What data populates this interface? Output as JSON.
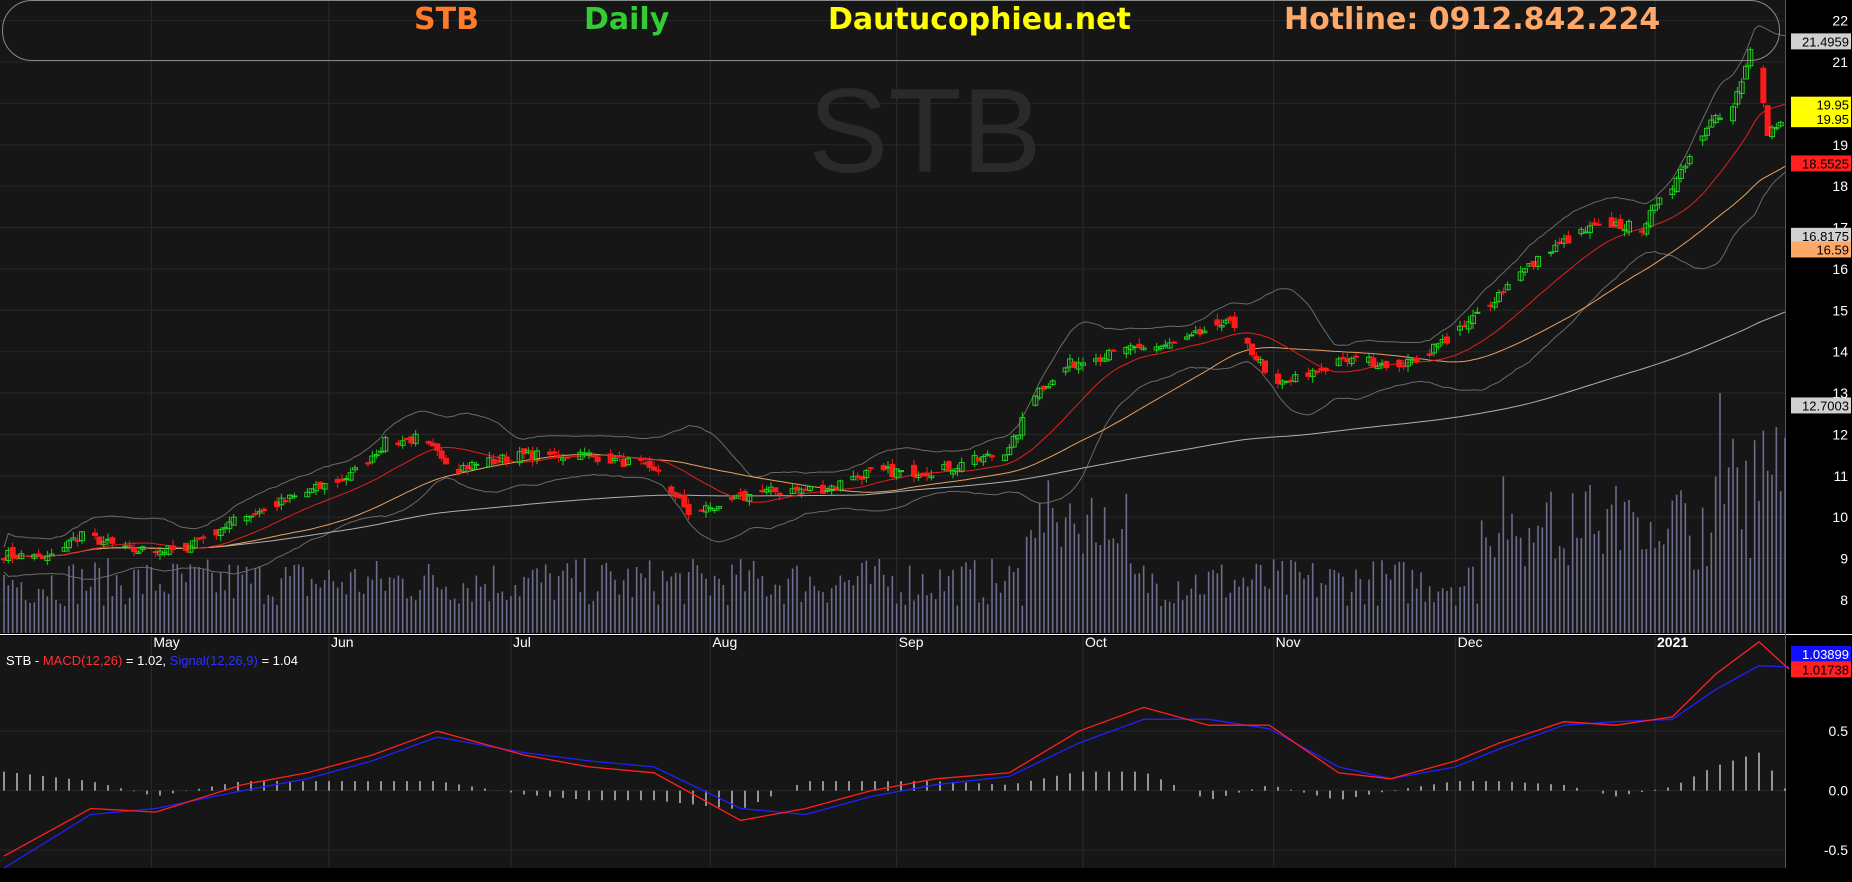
{
  "header": {
    "ticker": "STB",
    "timeframe": "Daily",
    "site": "Dautucophieu.net",
    "hotline": "Hotline: 0912.842.224",
    "colors": {
      "ticker": "#ff7a2a",
      "timeframe": "#33cc33",
      "site": "#ffff00",
      "hotline": "#ffa868"
    }
  },
  "watermark": "STB",
  "chart_data": {
    "type": "candlestick",
    "main": {
      "y_axis": {
        "range": [
          7.2,
          22.5
        ],
        "ticks": [
          8,
          9,
          10,
          11,
          12,
          13,
          14,
          15,
          16,
          17,
          18,
          19,
          20,
          21,
          22
        ]
      },
      "x_axis": {
        "labels": [
          {
            "label": "May",
            "day": 34
          },
          {
            "label": "Jun",
            "day": 75
          },
          {
            "label": "Jul",
            "day": 117
          },
          {
            "label": "Aug",
            "day": 163
          },
          {
            "label": "Sep",
            "day": 206
          },
          {
            "label": "Oct",
            "day": 249
          },
          {
            "label": "Nov",
            "day": 293
          },
          {
            "label": "Dec",
            "day": 335
          },
          {
            "label": "2021",
            "day": 381
          }
        ],
        "days": 411
      },
      "price_labels": [
        {
          "text": "21.4959",
          "value": 21.5,
          "bg": "#d0d0d0",
          "fg": "#000"
        },
        {
          "text": "19.95",
          "value": 19.97,
          "bg": "#ffff00",
          "fg": "#000"
        },
        {
          "text": "19.95",
          "value": 19.62,
          "bg": "#ffff00",
          "fg": "#000"
        },
        {
          "text": "18.5525",
          "value": 18.55,
          "bg": "#ff2020",
          "fg": "#000"
        },
        {
          "text": "16.8175",
          "value": 16.8,
          "bg": "#d0d0d0",
          "fg": "#000"
        },
        {
          "text": "16.59",
          "value": 16.47,
          "bg": "#ffa868",
          "fg": "#000"
        },
        {
          "text": "12.7003",
          "value": 12.7,
          "bg": "#d0d0d0",
          "fg": "#000"
        }
      ],
      "series_style": {
        "ma20": "#e02020",
        "ma50": "#e8a060",
        "ma200": "#b0b0b0",
        "bollinger": "#6a6a6a",
        "volume": "#6c6c8c",
        "up": "#1fd01f",
        "down": "#ff1a1a"
      }
    },
    "macd": {
      "label": {
        "prefix": "STB - ",
        "macd_name": "MACD(12,26)",
        "macd_value": " = 1.02, ",
        "signal_name": "Signal(12,26,9)",
        "signal_value": " = 1.04"
      },
      "y_axis": {
        "range": [
          -0.65,
          1.3
        ],
        "ticks": [
          -0.5,
          0.0,
          0.5
        ]
      },
      "tick_labels": [
        "-0.5",
        "0.0",
        "0.5"
      ],
      "value_labels": [
        {
          "text": "1.03899",
          "value": 1.15,
          "bg": "#1010ff",
          "fg": "#fff"
        },
        {
          "text": "1.01738",
          "value": 1.02,
          "bg": "#ff2020",
          "fg": "#000"
        }
      ],
      "macd_points": [
        [
          0,
          -0.55
        ],
        [
          20,
          -0.15
        ],
        [
          35,
          -0.18
        ],
        [
          55,
          0.05
        ],
        [
          70,
          0.15
        ],
        [
          85,
          0.3
        ],
        [
          100,
          0.5
        ],
        [
          120,
          0.3
        ],
        [
          135,
          0.2
        ],
        [
          150,
          0.15
        ],
        [
          170,
          -0.25
        ],
        [
          185,
          -0.15
        ],
        [
          200,
          0.0
        ],
        [
          215,
          0.1
        ],
        [
          232,
          0.15
        ],
        [
          248,
          0.5
        ],
        [
          263,
          0.7
        ],
        [
          278,
          0.55
        ],
        [
          292,
          0.55
        ],
        [
          308,
          0.15
        ],
        [
          320,
          0.1
        ],
        [
          335,
          0.25
        ],
        [
          345,
          0.4
        ],
        [
          360,
          0.58
        ],
        [
          372,
          0.55
        ],
        [
          385,
          0.62
        ],
        [
          395,
          0.98
        ],
        [
          405,
          1.25
        ],
        [
          412,
          1.02
        ]
      ],
      "signal_points": [
        [
          0,
          -0.65
        ],
        [
          20,
          -0.2
        ],
        [
          35,
          -0.15
        ],
        [
          55,
          0.0
        ],
        [
          70,
          0.1
        ],
        [
          85,
          0.25
        ],
        [
          100,
          0.45
        ],
        [
          120,
          0.32
        ],
        [
          135,
          0.25
        ],
        [
          150,
          0.2
        ],
        [
          170,
          -0.15
        ],
        [
          185,
          -0.2
        ],
        [
          200,
          -0.05
        ],
        [
          215,
          0.05
        ],
        [
          232,
          0.12
        ],
        [
          248,
          0.4
        ],
        [
          263,
          0.6
        ],
        [
          278,
          0.6
        ],
        [
          292,
          0.52
        ],
        [
          308,
          0.2
        ],
        [
          320,
          0.1
        ],
        [
          335,
          0.2
        ],
        [
          345,
          0.35
        ],
        [
          360,
          0.55
        ],
        [
          372,
          0.58
        ],
        [
          385,
          0.6
        ],
        [
          395,
          0.85
        ],
        [
          405,
          1.05
        ],
        [
          412,
          1.04
        ]
      ]
    }
  }
}
